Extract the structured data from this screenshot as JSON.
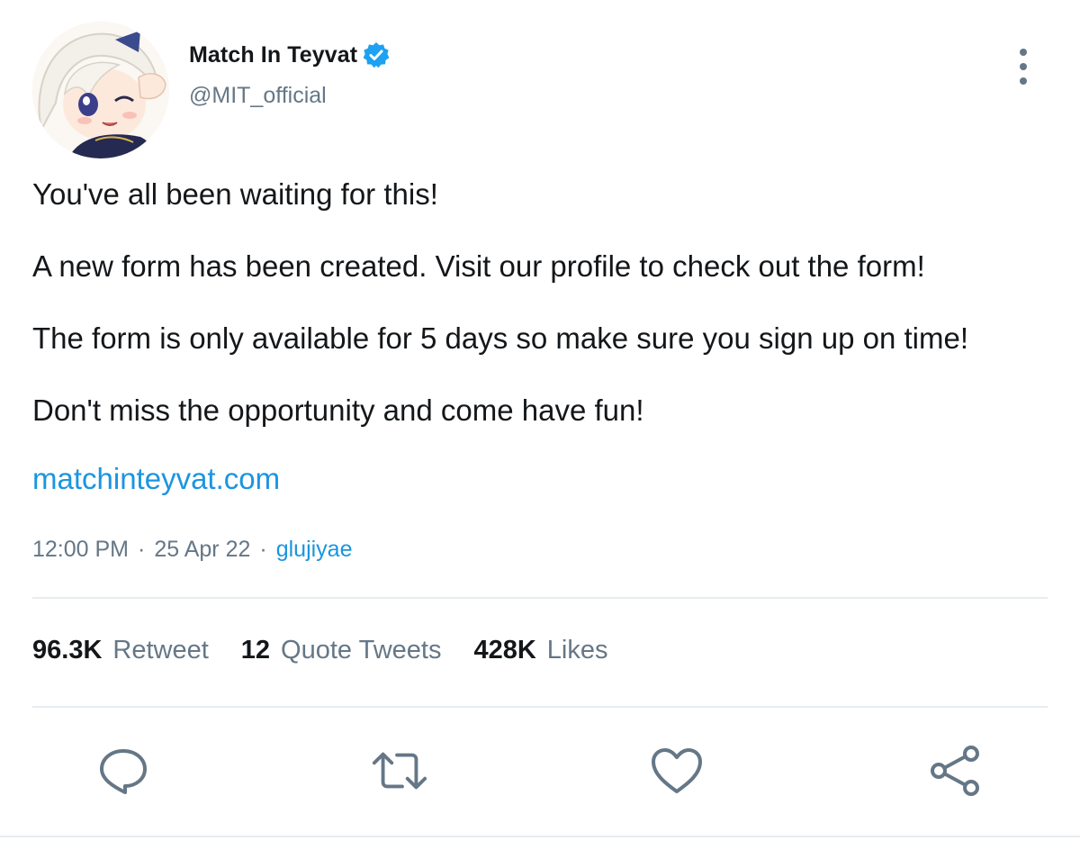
{
  "account": {
    "display_name": "Match In Teyvat",
    "handle": "@MIT_official",
    "verified": true
  },
  "tweet": {
    "paragraphs": [
      "You've all been waiting for this!",
      "A new form has been created. Visit our profile to check out the form!",
      "The form is only available for 5 days so make sure you sign up on time!",
      "Don't miss the opportunity and come have fun!"
    ],
    "link": "matchinteyvat.com",
    "time": "12:00 PM",
    "separator": "·",
    "date": "25 Apr 22",
    "via": "glujiyae"
  },
  "stats": {
    "retweets_count": "96.3K",
    "retweets_label": "Retweet",
    "quotes_count": "12",
    "quotes_label": "Quote Tweets",
    "likes_count": "428K",
    "likes_label": "Likes"
  },
  "actions": {
    "reply_icon": "reply-icon",
    "retweet_icon": "retweet-icon",
    "like_icon": "heart-icon",
    "share_icon": "share-icon"
  },
  "colors": {
    "accent": "#1b95e0",
    "verified": "#1da1f2",
    "muted": "#657786",
    "text": "#14171a",
    "divider": "#e6ecf0"
  }
}
